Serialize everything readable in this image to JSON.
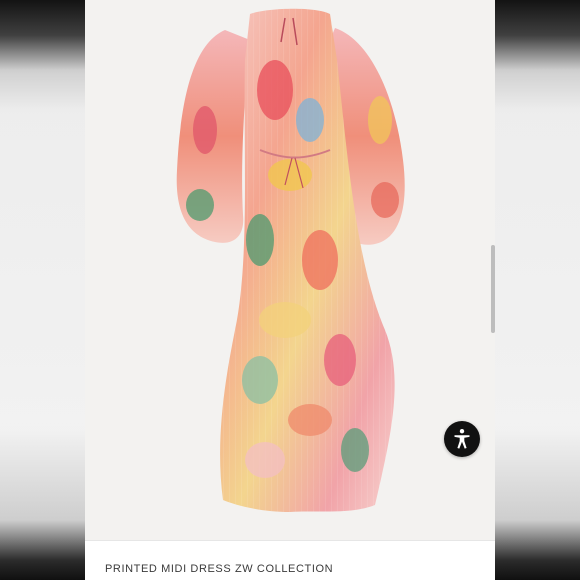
{
  "product": {
    "caption": "PRINTED MIDI DRESS ZW COLLECTION",
    "image_alt": "Printed midi dress with balloon sleeves in pink, coral, yellow and green watercolor print"
  },
  "icons": {
    "accessibility": "accessibility-icon"
  },
  "colors": {
    "accent_button": "#111111",
    "caption_text": "#3a3a3a"
  }
}
